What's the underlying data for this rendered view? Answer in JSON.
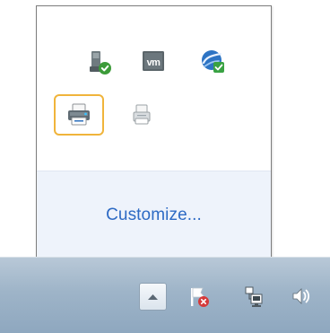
{
  "tray_flyout": {
    "customize_label": "Customize...",
    "icons": [
      {
        "name": "usb-safely-remove-icon",
        "status": "ok"
      },
      {
        "name": "vmware-tray-icon",
        "text": "vm"
      },
      {
        "name": "network-globe-icon",
        "status": "ok"
      },
      {
        "name": "printer-icon",
        "selected": true
      },
      {
        "name": "printer-small-icon"
      }
    ]
  },
  "taskbar": {
    "show_hidden_icon": "up-arrow-icon",
    "tray_icons": [
      "action-center-flag-icon",
      "network-icon",
      "volume-icon"
    ]
  },
  "colors": {
    "accent_link": "#2d6ac4",
    "selected_outline": "#f0b43b",
    "taskbar_top": "#b8c8d7",
    "taskbar_bottom": "#8ea7bf"
  }
}
